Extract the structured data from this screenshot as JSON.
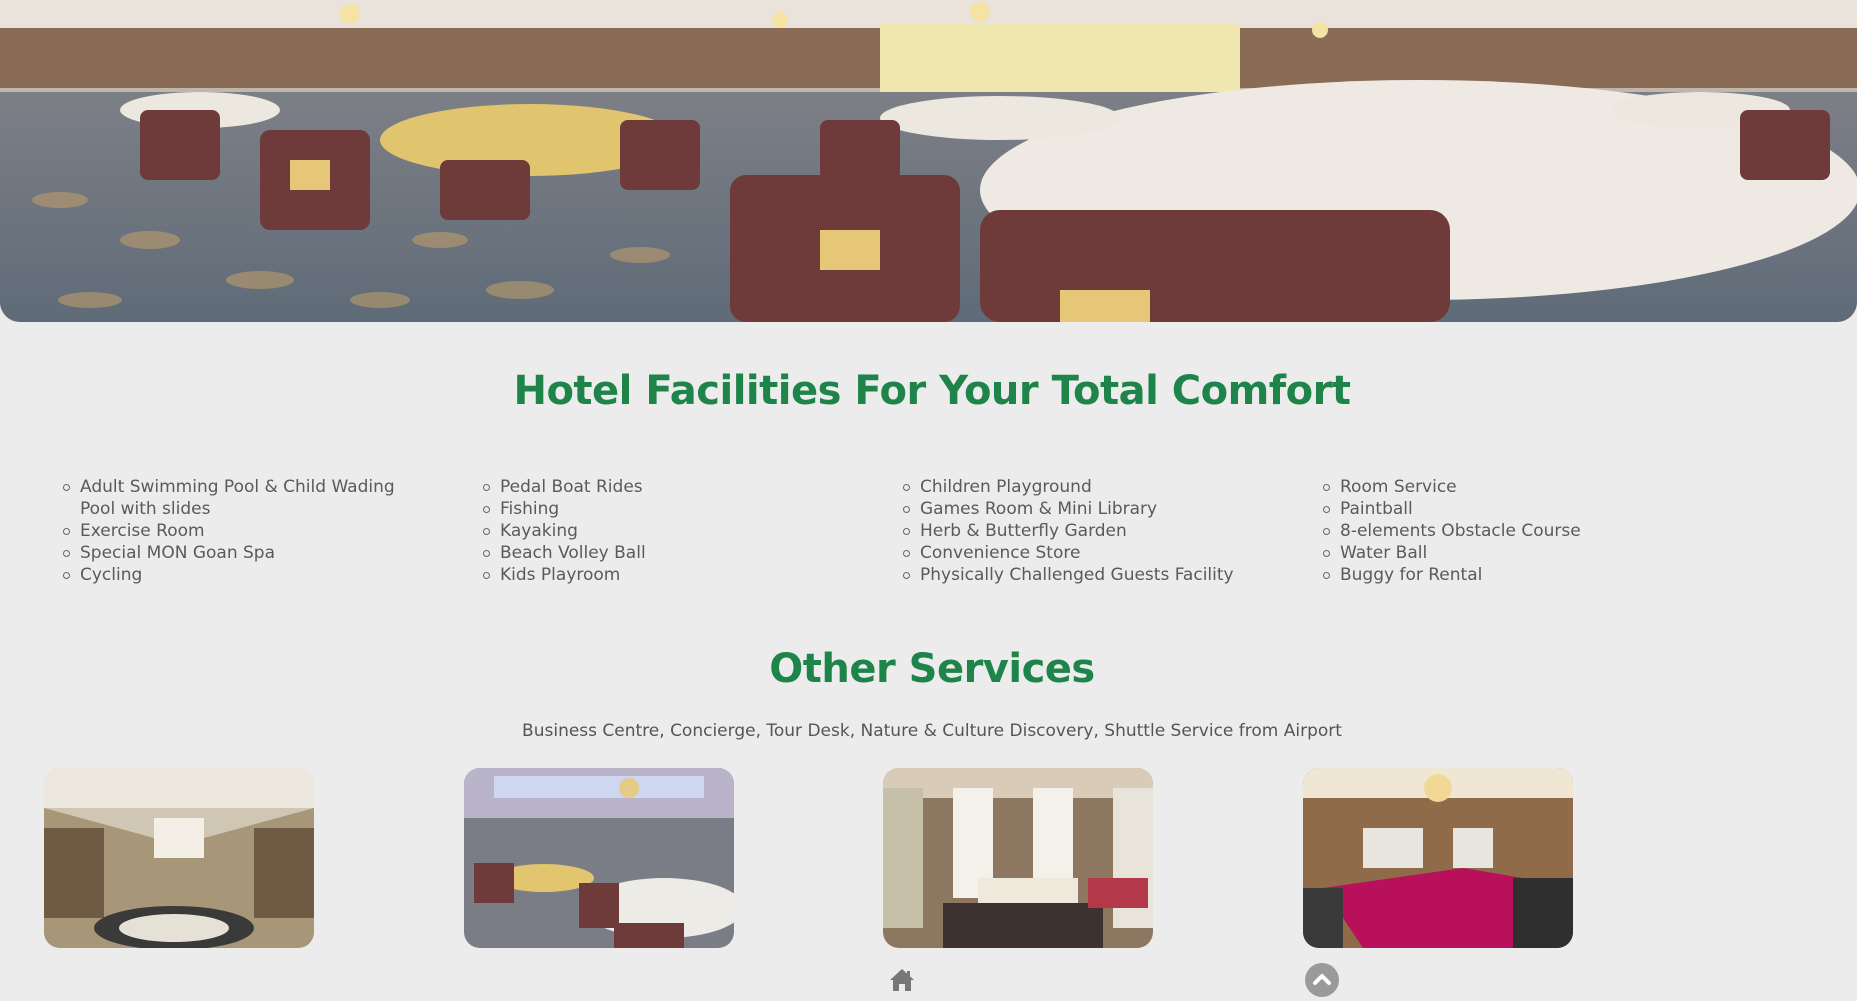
{
  "hero": {
    "image": "ballroom-banquet-hall-photo"
  },
  "facilities": {
    "heading": "Hotel Facilities For Your Total Comfort",
    "columns": [
      [
        "Adult Swimming Pool & Child Wading Pool with slides",
        "Exercise Room",
        "Special MON Goan Spa",
        "Cycling"
      ],
      [
        "Pedal Boat Rides",
        "Fishing",
        "Kayaking",
        "Beach Volley Ball",
        "Kids Playroom"
      ],
      [
        "Children Playground",
        "Games Room & Mini Library",
        "Herb & Butterfly Garden",
        "Convenience Store",
        "Physically Challenged Guests Facility"
      ],
      [
        "Room Service",
        "Paintball",
        "8-elements Obstacle Course",
        "Water Ball",
        "Buggy for Rental"
      ]
    ]
  },
  "other_services": {
    "heading": "Other Services",
    "text": "Business Centre, Concierge, Tour Desk, Nature & Culture Discovery, Shuttle Service from Airport"
  },
  "thumbnails": [
    "lobby-photo",
    "ballroom-photo",
    "canopy-bedroom-photo",
    "meeting-room-photo"
  ],
  "footer_icons": {
    "home": "home-icon",
    "up": "chevron-up-icon"
  },
  "colors": {
    "heading_green": "#1e8449",
    "page_bg": "#ececec",
    "body_text": "#555555"
  }
}
